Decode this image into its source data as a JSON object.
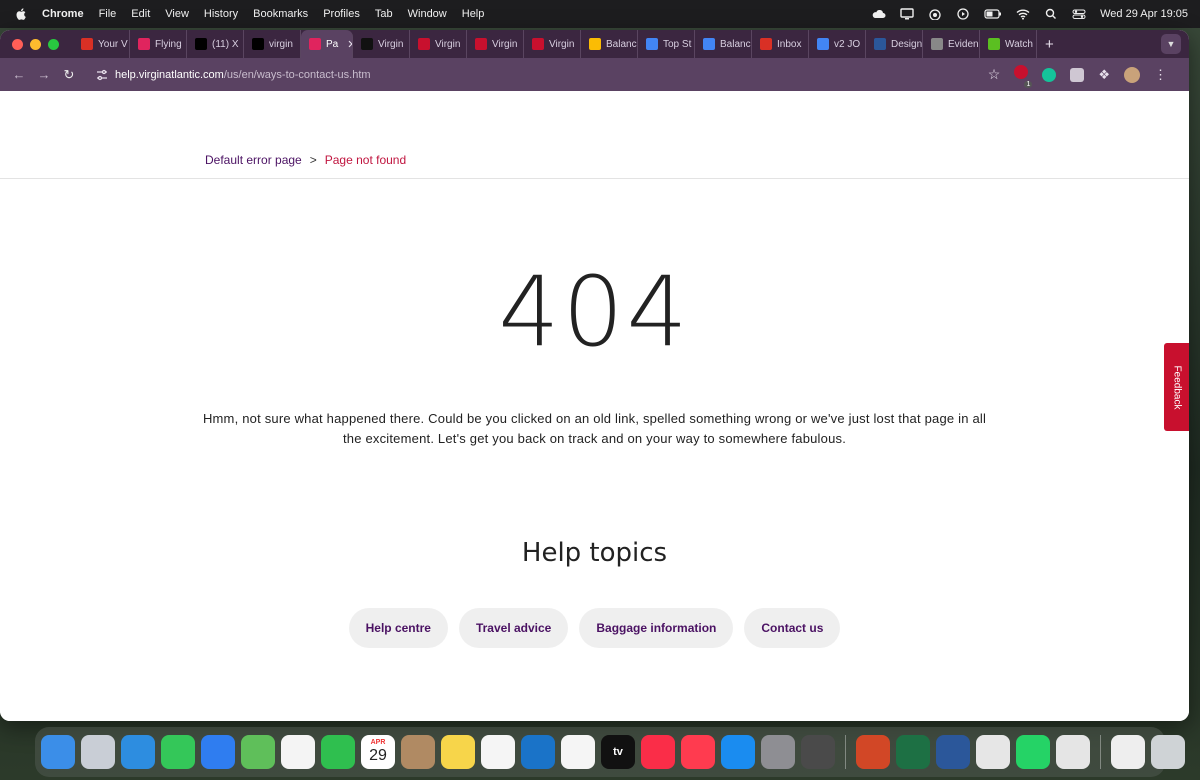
{
  "menubar": {
    "app_name": "Chrome",
    "items": [
      "File",
      "Edit",
      "View",
      "History",
      "Bookmarks",
      "Profiles",
      "Tab",
      "Window",
      "Help"
    ],
    "datetime": "Wed 29 Apr  19:05"
  },
  "browser": {
    "tabs": [
      {
        "label": "Your V",
        "icon": "gmail-icon",
        "color": "#d93025"
      },
      {
        "label": "Flying",
        "icon": "virgin-flying-icon",
        "color": "#e0245e"
      },
      {
        "label": "(11) X",
        "icon": "x-icon",
        "color": "#000000"
      },
      {
        "label": "virgin",
        "icon": "x-icon",
        "color": "#000000"
      },
      {
        "label": "Pa",
        "icon": "virgin-flying-icon",
        "color": "#e0245e",
        "active": true
      },
      {
        "label": "Virgin",
        "icon": "ms-icon",
        "color": "#111111"
      },
      {
        "label": "Virgin",
        "icon": "virgin-icon",
        "color": "#c8102e"
      },
      {
        "label": "Virgin",
        "icon": "virgin-icon",
        "color": "#c8102e"
      },
      {
        "label": "Virgin",
        "icon": "virgin-icon",
        "color": "#c8102e"
      },
      {
        "label": "Balanc",
        "icon": "drive-icon",
        "color": "#fbbc04"
      },
      {
        "label": "Top St",
        "icon": "docs-icon",
        "color": "#4285f4"
      },
      {
        "label": "Balanc",
        "icon": "docs-icon",
        "color": "#4285f4"
      },
      {
        "label": "Inbox",
        "icon": "gmail-icon",
        "color": "#d93025"
      },
      {
        "label": "v2 JO",
        "icon": "docs-icon",
        "color": "#4285f4"
      },
      {
        "label": "Design",
        "icon": "word-icon",
        "color": "#2b579a"
      },
      {
        "label": "Eviden",
        "icon": "globe-icon",
        "color": "#888888"
      },
      {
        "label": "Watch",
        "icon": "channel4-icon",
        "color": "#5bbf21"
      }
    ],
    "url_domain": "help.virginatlantic.com",
    "url_path": "/us/en/ways-to-contact-us.htm",
    "extension_badge": "1"
  },
  "page": {
    "breadcrumb": {
      "parent": "Default error page",
      "separator": ">",
      "current": "Page not found"
    },
    "error_code": "404",
    "message": "Hmm, not sure what happened there. Could be you clicked on an old link, spelled something wrong or we've just lost that page in all the excitement. Let's get you back on track and on your way to somewhere fabulous.",
    "help_title": "Help topics",
    "topics": [
      "Help centre",
      "Travel advice",
      "Baggage information",
      "Contact us"
    ],
    "feedback_label": "Feedback"
  },
  "dock": {
    "calendar_month": "APR",
    "calendar_day": "29",
    "tv_label": "tv",
    "apps": [
      "finder",
      "launchpad",
      "safari",
      "messages",
      "mail",
      "maps",
      "photos",
      "facetime",
      "calendar",
      "contacts",
      "notes",
      "reminders",
      "outlook",
      "freeform",
      "tv",
      "music",
      "news",
      "app-store",
      "settings",
      "iphone-mirroring",
      "powerpoint",
      "excel",
      "word",
      "preview",
      "whatsapp",
      "chrome",
      "file",
      "trash"
    ]
  },
  "colors": {
    "brand_purple": "#4b1263",
    "brand_red": "#c8102e",
    "tab_bar": "#3b2640",
    "toolbar": "#5a4262"
  }
}
